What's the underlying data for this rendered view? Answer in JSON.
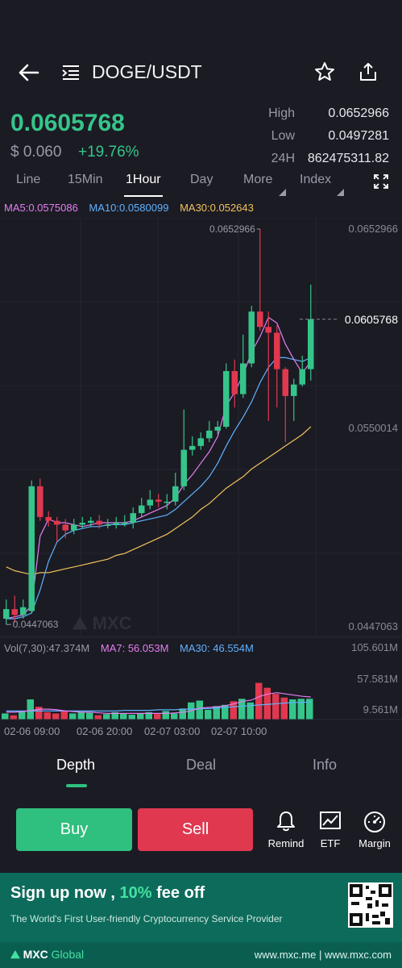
{
  "header": {
    "pair": "DOGE/USDT"
  },
  "ticker": {
    "last_price": "0.0605768",
    "usd_price": "$ 0.060",
    "change": "+19.76%",
    "high_label": "High",
    "high_value": "0.0652966",
    "low_label": "Low",
    "low_value": "0.0497281",
    "vol_label": "24H",
    "vol_value": "862475311.82"
  },
  "tabs": [
    "Line",
    "15Min",
    "1Hour",
    "Day",
    "More",
    "Index"
  ],
  "active_tab": "1Hour",
  "indicators": {
    "ma5": "MA5:0.0575086",
    "ma10": "MA10:0.0580099",
    "ma30": "MA30:0.052643"
  },
  "volume_indicators": {
    "vol": "Vol(7,30):47.374M",
    "ma7_label": "MA7:",
    "ma7_value": "56.053M",
    "ma30_label": "MA30:",
    "ma30_value": "46.554M"
  },
  "chart_data": {
    "type": "candlestick",
    "price_axis_labels": [
      "0.0652966",
      "0.0550014",
      "0.0447063"
    ],
    "current_price_label": "0.0605768",
    "max_marker": "0.0652966",
    "min_marker": "0.0447063",
    "ylim": [
      0.0447063,
      0.0652966
    ],
    "volume_axis_labels": [
      "105.601M",
      "57.581M",
      "9.561M"
    ],
    "volume_ylim": [
      0,
      105.601
    ],
    "x_labels": [
      "02-06 09:00",
      "02-06 20:00",
      "02-07 03:00",
      "02-07 10:00"
    ],
    "candles": [
      {
        "o": 0.045,
        "c": 0.0455,
        "h": 0.046,
        "l": 0.0447
      },
      {
        "o": 0.0455,
        "c": 0.0452,
        "h": 0.0462,
        "l": 0.0448
      },
      {
        "o": 0.0452,
        "c": 0.0456,
        "h": 0.046,
        "l": 0.045
      },
      {
        "o": 0.0454,
        "c": 0.0519,
        "h": 0.0522,
        "l": 0.0453
      },
      {
        "o": 0.0519,
        "c": 0.0503,
        "h": 0.0523,
        "l": 0.0501
      },
      {
        "o": 0.0503,
        "c": 0.0501,
        "h": 0.0506,
        "l": 0.0498
      },
      {
        "o": 0.0501,
        "c": 0.0499,
        "h": 0.0503,
        "l": 0.049
      },
      {
        "o": 0.0499,
        "c": 0.0496,
        "h": 0.0502,
        "l": 0.0492
      },
      {
        "o": 0.0496,
        "c": 0.0499,
        "h": 0.0502,
        "l": 0.0494
      },
      {
        "o": 0.0499,
        "c": 0.05,
        "h": 0.0503,
        "l": 0.0497
      },
      {
        "o": 0.05,
        "c": 0.0501,
        "h": 0.0503,
        "l": 0.0498
      },
      {
        "o": 0.0501,
        "c": 0.0499,
        "h": 0.0504,
        "l": 0.0497
      },
      {
        "o": 0.0499,
        "c": 0.0499,
        "h": 0.0502,
        "l": 0.0497
      },
      {
        "o": 0.0499,
        "c": 0.05,
        "h": 0.0503,
        "l": 0.0497
      },
      {
        "o": 0.05,
        "c": 0.05,
        "h": 0.0504,
        "l": 0.0498
      },
      {
        "o": 0.05,
        "c": 0.0505,
        "h": 0.0508,
        "l": 0.0497
      },
      {
        "o": 0.0505,
        "c": 0.0509,
        "h": 0.0513,
        "l": 0.0503
      },
      {
        "o": 0.0509,
        "c": 0.0512,
        "h": 0.0517,
        "l": 0.0507
      },
      {
        "o": 0.0512,
        "c": 0.0511,
        "h": 0.0515,
        "l": 0.0508
      },
      {
        "o": 0.0511,
        "c": 0.0511,
        "h": 0.0515,
        "l": 0.0507
      },
      {
        "o": 0.0511,
        "c": 0.0519,
        "h": 0.0526,
        "l": 0.0509
      },
      {
        "o": 0.0519,
        "c": 0.0538,
        "h": 0.0559,
        "l": 0.0517
      },
      {
        "o": 0.0538,
        "c": 0.054,
        "h": 0.0545,
        "l": 0.0535
      },
      {
        "o": 0.054,
        "c": 0.0544,
        "h": 0.0547,
        "l": 0.0538
      },
      {
        "o": 0.0544,
        "c": 0.0548,
        "h": 0.0553,
        "l": 0.0542
      },
      {
        "o": 0.0548,
        "c": 0.055,
        "h": 0.0553,
        "l": 0.0546
      },
      {
        "o": 0.055,
        "c": 0.0579,
        "h": 0.0583,
        "l": 0.0549
      },
      {
        "o": 0.0579,
        "c": 0.0567,
        "h": 0.0585,
        "l": 0.056
      },
      {
        "o": 0.0567,
        "c": 0.0583,
        "h": 0.0598,
        "l": 0.0565
      },
      {
        "o": 0.0583,
        "c": 0.061,
        "h": 0.0613,
        "l": 0.0581
      },
      {
        "o": 0.061,
        "c": 0.0602,
        "h": 0.0653,
        "l": 0.06
      },
      {
        "o": 0.0602,
        "c": 0.0599,
        "h": 0.061,
        "l": 0.0553
      },
      {
        "o": 0.0599,
        "c": 0.058,
        "h": 0.0603,
        "l": 0.056
      },
      {
        "o": 0.058,
        "c": 0.0566,
        "h": 0.0581,
        "l": 0.0542
      },
      {
        "o": 0.0566,
        "c": 0.0572,
        "h": 0.0575,
        "l": 0.0553
      },
      {
        "o": 0.0572,
        "c": 0.058,
        "h": 0.0587,
        "l": 0.0571
      },
      {
        "o": 0.058,
        "c": 0.0606,
        "h": 0.0624,
        "l": 0.0574
      }
    ],
    "ma5": [
      0.045,
      0.0451,
      0.0452,
      0.0457,
      0.0493,
      0.0502,
      0.05,
      0.05,
      0.0499,
      0.0498,
      0.0499,
      0.05,
      0.05,
      0.05,
      0.05,
      0.0501,
      0.0503,
      0.0505,
      0.0507,
      0.0509,
      0.0513,
      0.052,
      0.0525,
      0.0531,
      0.0537,
      0.0545,
      0.0561,
      0.0568,
      0.0577,
      0.0589,
      0.0597,
      0.0607,
      0.0604,
      0.0593,
      0.0585,
      0.0578,
      0.0584
    ],
    "ma10": [
      0.045,
      0.045,
      0.0451,
      0.0453,
      0.0465,
      0.048,
      0.049,
      0.0494,
      0.0496,
      0.0497,
      0.0498,
      0.0498,
      0.0499,
      0.0499,
      0.0499,
      0.05,
      0.0501,
      0.0502,
      0.0503,
      0.0504,
      0.0507,
      0.0511,
      0.0515,
      0.0519,
      0.0524,
      0.0531,
      0.054,
      0.0548,
      0.0555,
      0.0563,
      0.0573,
      0.0581,
      0.0586,
      0.0586,
      0.0585,
      0.0584,
      0.0586
    ],
    "ma30": [
      0.0477,
      0.0475,
      0.0474,
      0.0473,
      0.0474,
      0.0474,
      0.0475,
      0.0476,
      0.0477,
      0.0478,
      0.0479,
      0.048,
      0.0481,
      0.0483,
      0.0484,
      0.0486,
      0.0488,
      0.049,
      0.0492,
      0.0494,
      0.0497,
      0.05,
      0.0503,
      0.0507,
      0.051,
      0.0514,
      0.0518,
      0.0521,
      0.0524,
      0.0528,
      0.0531,
      0.0534,
      0.0537,
      0.054,
      0.0543,
      0.0546,
      0.055
    ],
    "volumes": [
      10,
      7,
      14,
      33,
      21,
      12,
      10,
      14,
      10,
      12,
      11,
      7,
      9,
      12,
      10,
      8,
      10,
      12,
      9,
      14,
      10,
      18,
      28,
      31,
      16,
      22,
      24,
      30,
      34,
      28,
      60,
      52,
      42,
      36,
      33,
      34,
      34
    ],
    "vol_ma7": [
      12,
      12,
      13,
      15,
      17,
      17,
      16,
      14,
      13,
      12,
      12,
      11,
      10,
      10,
      10,
      10,
      10,
      10,
      10,
      10,
      11,
      12,
      15,
      19,
      20,
      21,
      23,
      26,
      30,
      32,
      38,
      42,
      44,
      42,
      40,
      38,
      37
    ],
    "vol_ma30": [
      14,
      14,
      14,
      14,
      14,
      14,
      14,
      14,
      14,
      14,
      14,
      14,
      14,
      14,
      15,
      15,
      15,
      15,
      16,
      16,
      16,
      17,
      17,
      18,
      18,
      19,
      20,
      21,
      22,
      23,
      24,
      25,
      26,
      27,
      28,
      28,
      29
    ],
    "colors": {
      "up": "#35c58a",
      "down": "#e0384f",
      "ma5": "#e47ff0",
      "ma10": "#5fb2ff",
      "ma30": "#f0c25a"
    }
  },
  "bottom_tabs": [
    "Depth",
    "Deal",
    "Info"
  ],
  "active_bottom_tab": "Depth",
  "actions": {
    "buy": "Buy",
    "sell": "Sell",
    "remind": "Remind",
    "etf": "ETF",
    "margin": "Margin"
  },
  "banner": {
    "headline_a": "Sign up now , ",
    "headline_b": "10%",
    "headline_c": " fee off",
    "subline": "The World's First User-friendly Cryptocurrency Service Provider",
    "logo_a": "MXC",
    "logo_b": " Global",
    "urls": "www.mxc.me | www.mxc.com"
  }
}
